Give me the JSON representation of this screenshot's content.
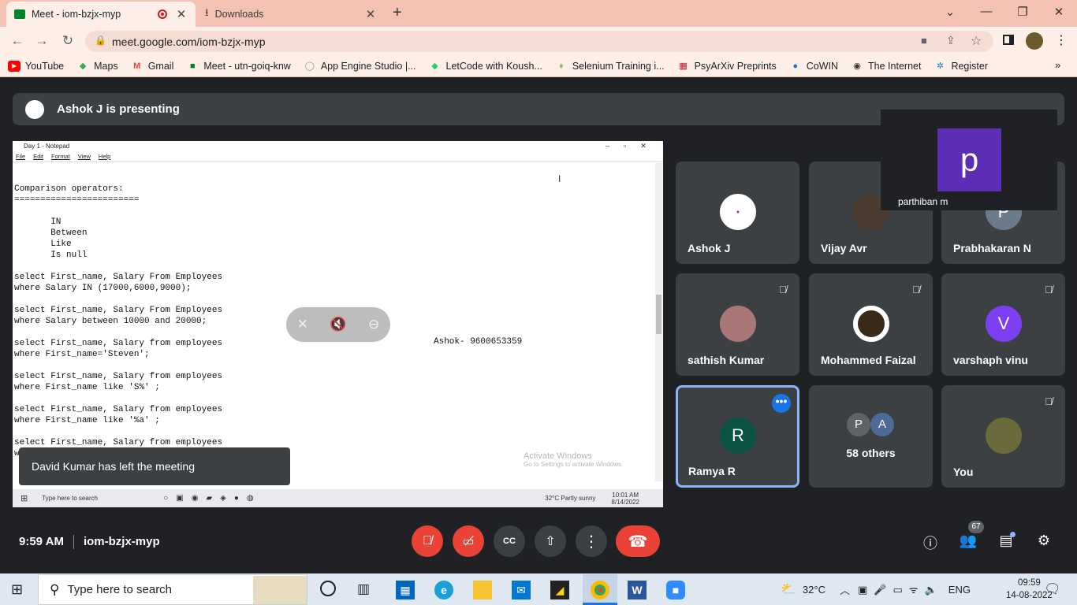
{
  "browser": {
    "tabs": [
      {
        "label": "Meet - iom-bzjx-myp",
        "recording": true
      },
      {
        "label": "Downloads"
      }
    ],
    "url": "meet.google.com/iom-bzjx-myp",
    "bookmarks": [
      "YouTube",
      "Maps",
      "Gmail",
      "Meet - utn-goiq-knw",
      "App Engine Studio |...",
      "LetCode with Koush...",
      "Selenium Training i...",
      "PsyArXiv Preprints",
      "CoWIN",
      "The Internet",
      "Register"
    ]
  },
  "meet": {
    "presenting_banner": "Ashok J is presenting",
    "meeting_time": "9:59 AM",
    "meeting_code": "iom-bzjx-myp",
    "toast": "David Kumar has left the meeting",
    "people_count": "67",
    "participants": [
      {
        "name": "Ashok J",
        "initial": "",
        "avatar_color": "#ffffff",
        "muted": false
      },
      {
        "name": "Vijay Avr",
        "initial": "",
        "avatar_color": "#4a3b30",
        "muted": false
      },
      {
        "name": "Prabhakaran N",
        "initial": "P",
        "avatar_color": "#6b7b8c",
        "muted": false
      },
      {
        "name": "sathish Kumar",
        "initial": "",
        "avatar_color": "#a77",
        "muted": true
      },
      {
        "name": "Mohammed Faizal",
        "initial": "",
        "avatar_color": "#3a2a1a",
        "muted": true
      },
      {
        "name": "varshaph vinu",
        "initial": "V",
        "avatar_color": "#7e3ff2",
        "muted": true
      },
      {
        "name": "Ramya R",
        "initial": "R",
        "avatar_color": "#0b5345",
        "muted": false
      },
      {
        "name": "58 others",
        "initial": "",
        "avatar_color": "#3c4043",
        "muted": false
      },
      {
        "name": "You",
        "initial": "",
        "avatar_color": "#6a6a3a",
        "muted": true
      }
    ],
    "others_initials": [
      "P",
      "A"
    ],
    "pip": {
      "initial": "p",
      "name": "parthiban m"
    }
  },
  "shared_screen": {
    "notepad_title": "Day 1 - Notepad",
    "menu": [
      "File",
      "Edit",
      "Format",
      "View",
      "Help"
    ],
    "text": "Comparison operators:\n========================\n\n       IN\n       Between\n       Like\n       Is null\n\nselect First_name, Salary From Employees\nwhere Salary IN (17000,6000,9000);\n\nselect First_name, Salary From Employees\nwhere Salary between 10000 and 20000;\n\nselect First_name, Salary from employees\nwhere First_name='Steven';\n\nselect First_name, Salary from employees\nwhere First_name like 'S%' ;\n\nselect First_name, Salary from employees\nwhere First_name like '%a' ;\n\nselect First_name, Salary from employees\nw",
    "note": "Ashok- 9600653359",
    "activate_title": "Activate Windows",
    "activate_sub": "Go to Settings to activate Windows.",
    "inner_search": "Type here to search",
    "inner_weather": "32°C  Partly sunny",
    "inner_time": "10:01 AM",
    "inner_date": "8/14/2022"
  },
  "taskbar": {
    "search_placeholder": "Type here to search",
    "temperature": "32°C",
    "language": "ENG",
    "time": "09:59",
    "date": "14-08-2022"
  },
  "colors": {
    "meet_bg": "#202124",
    "tile_bg": "#3c4043",
    "end_call": "#ea4335",
    "active_border": "#8ab4f8",
    "tab_strip": "#f3c2b3"
  }
}
